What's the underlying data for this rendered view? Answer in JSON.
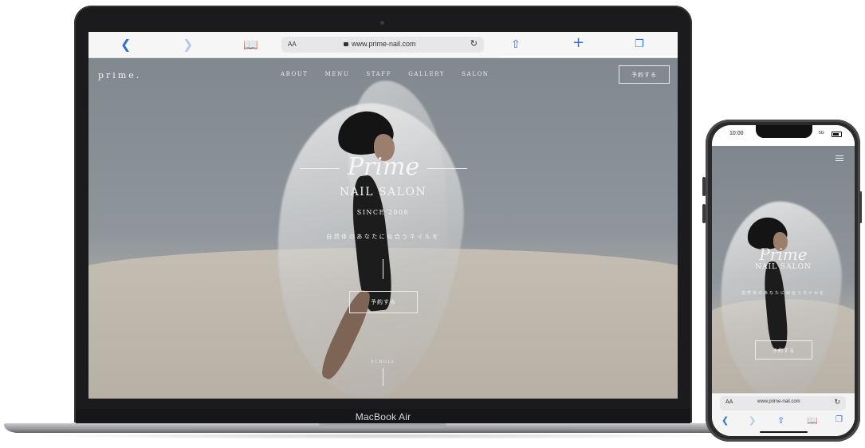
{
  "laptop": {
    "device_label": "MacBook Air",
    "browser": {
      "url_aa": "AA",
      "url": "www.prime-nail.com",
      "icons": [
        "back-icon",
        "forward-icon",
        "bookmarks-icon",
        "reload-icon",
        "share-icon",
        "new-tab-icon",
        "tabs-icon"
      ]
    },
    "site": {
      "logo": "prime.",
      "nav": [
        "ABOUT",
        "MENU",
        "STAFF",
        "GALLERY",
        "SALON"
      ],
      "nav_button": "予約する",
      "hero_script": "Prime",
      "hero_title": "NAIL SALON",
      "hero_since": "SINCE 2006",
      "hero_tagline": "自然体のあなたに似合うネイルを",
      "hero_button": "予約する",
      "scroll_label": "SCROLL"
    }
  },
  "phone": {
    "status_time": "10:00",
    "status_signal": "5G",
    "site": {
      "hero_script": "Prime",
      "hero_title": "NAIL SALON",
      "hero_tagline": "自然体のあなたに似合うネイルを",
      "hero_button": "予約する"
    },
    "browser": {
      "url_aa": "AA",
      "url": "www.prime-nail.com"
    }
  },
  "colors": {
    "browser_accent": "#2f6fd8",
    "device_body": "#1b1b1d",
    "hero_text": "#f4f4f4"
  }
}
